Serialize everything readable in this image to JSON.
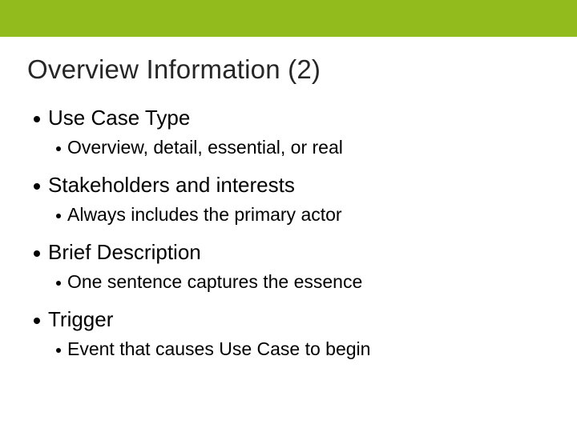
{
  "colors": {
    "accent": "#92bc1e"
  },
  "slide": {
    "title": "Overview Information (2)",
    "items": [
      {
        "label": "Use Case Type",
        "sub": "Overview, detail, essential, or real"
      },
      {
        "label": "Stakeholders and interests",
        "sub": "Always includes the primary actor"
      },
      {
        "label": "Brief Description",
        "sub": "One sentence captures the essence"
      },
      {
        "label": "Trigger",
        "sub": "Event that causes Use Case to begin"
      }
    ]
  }
}
